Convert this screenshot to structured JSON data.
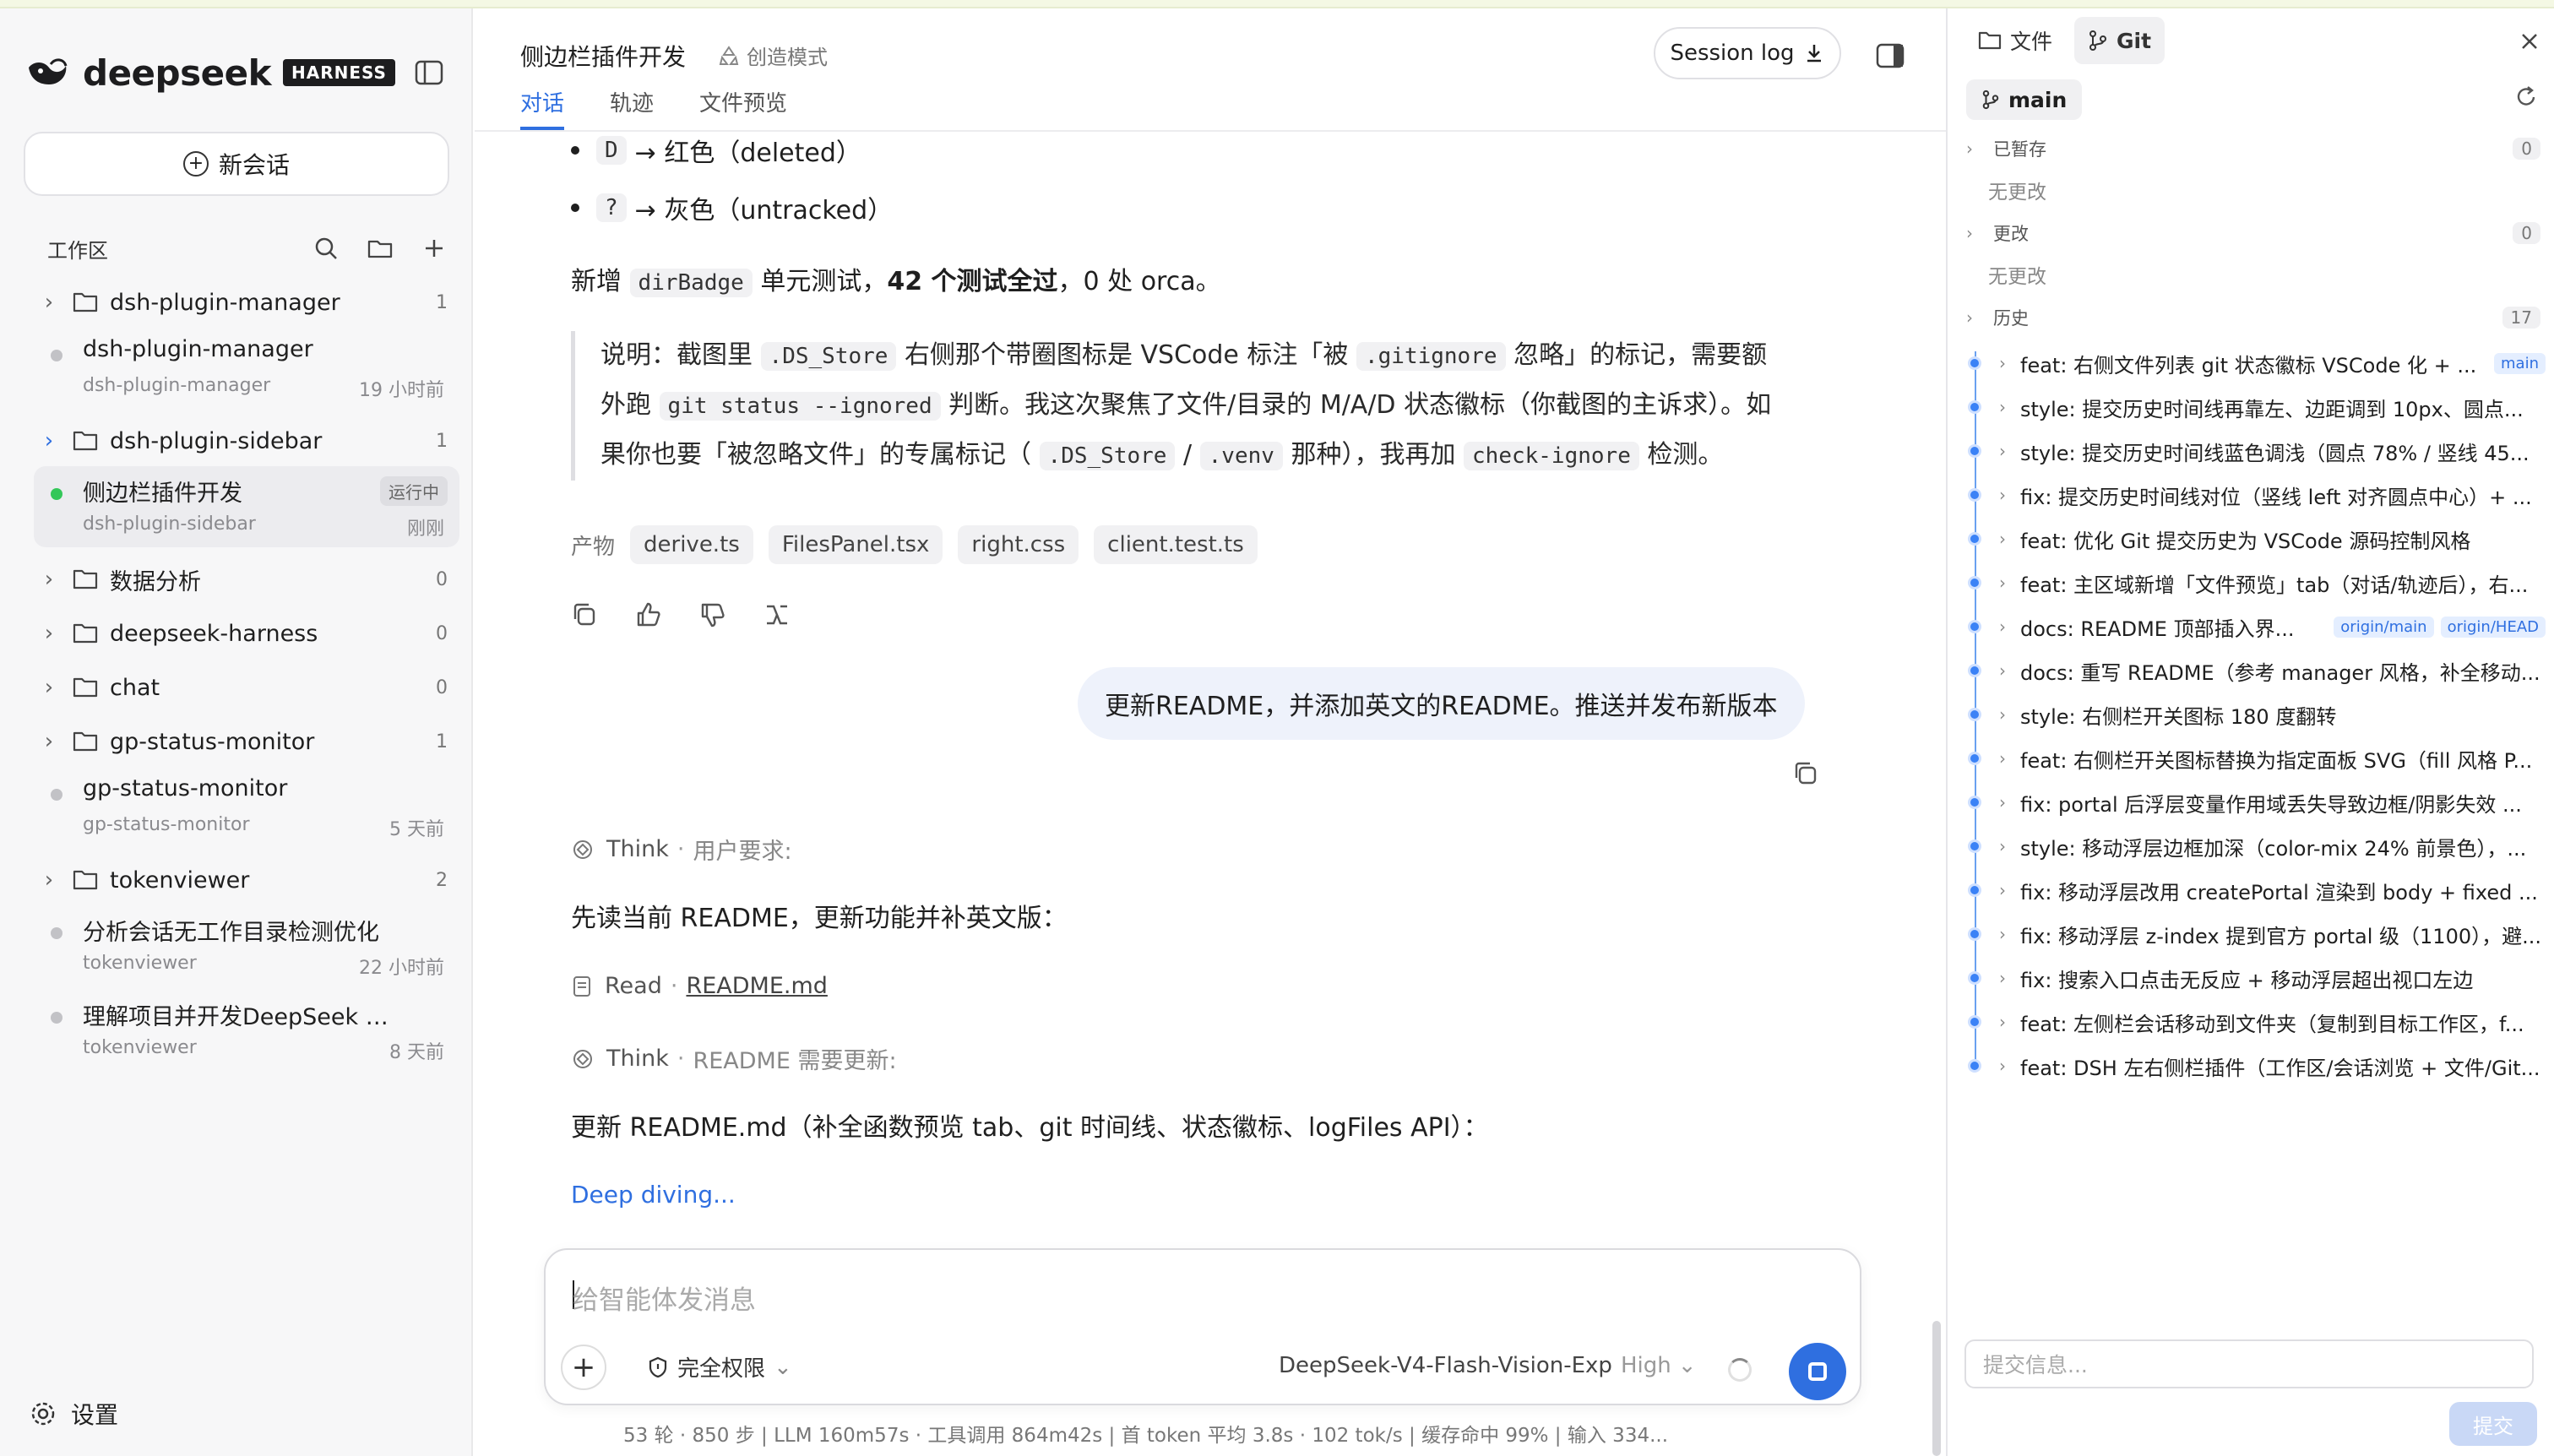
{
  "brand": {
    "name": "deepseek",
    "badge": "HARNESS"
  },
  "sidebar": {
    "new_chat": "新会话",
    "workspace_title": "工作区",
    "items": [
      {
        "kind": "folder",
        "name": "dsh-plugin-manager",
        "count": "1",
        "expanded": false
      },
      {
        "kind": "session",
        "title": "dsh-plugin-manager",
        "sub": "dsh-plugin-manager",
        "time": "19 小时前",
        "status": "idle"
      },
      {
        "kind": "folder",
        "name": "dsh-plugin-sidebar",
        "count": "1",
        "expanded": true
      },
      {
        "kind": "session",
        "title": "侧边栏插件开发",
        "sub": "dsh-plugin-sidebar",
        "time": "刚刚",
        "badge": "运行中",
        "status": "running"
      },
      {
        "kind": "folder",
        "name": "数据分析",
        "count": "0"
      },
      {
        "kind": "folder",
        "name": "deepseek-harness",
        "count": "0"
      },
      {
        "kind": "folder",
        "name": "chat",
        "count": "0"
      },
      {
        "kind": "folder",
        "name": "gp-status-monitor",
        "count": "1"
      },
      {
        "kind": "session",
        "title": "gp-status-monitor",
        "sub": "gp-status-monitor",
        "time": "5 天前",
        "status": "idle"
      },
      {
        "kind": "folder",
        "name": "tokenviewer",
        "count": "2"
      },
      {
        "kind": "session",
        "title": "分析会话无工作目录检测优化",
        "sub": "tokenviewer",
        "time": "22 小时前",
        "status": "idle"
      },
      {
        "kind": "session",
        "title": "理解项目并开发DeepSeek Harne...",
        "sub": "tokenviewer",
        "time": "8 天前",
        "status": "idle"
      }
    ],
    "settings": "设置"
  },
  "header": {
    "title": "侧边栏插件开发",
    "mode": "创造模式",
    "tabs": [
      "对话",
      "轨迹",
      "文件预览"
    ],
    "session_log": "Session log"
  },
  "conversation": {
    "bullet1_code": "D",
    "bullet1_text": "→ 红色（deleted）",
    "bullet2_code": "?",
    "bullet2_text": "→ 灰色（untracked）",
    "p1_a": "新增",
    "p1_code": "dirBadge",
    "p1_b": "单元测试，",
    "p1_bold": "42 个测试全过",
    "p1_c": "，0 处 orca。",
    "quote": {
      "t1": "说明：截图里",
      "c1": ".DS_Store",
      "t2": "右侧那个带圈图标是 VSCode 标注「被",
      "c2": ".gitignore",
      "t3": "忽略」的标记，需要额",
      "t4": "外跑",
      "c3": "git status --ignored",
      "t5": "判断。我这次聚焦了文件/目录的 M/A/D 状态徽标（你截图的主诉求）。如",
      "t6": "果你也要「被忽略文件」的专属标记（",
      "c4": ".DS_Store",
      "t7": "/",
      "c5": ".venv",
      "t8": "那种），我再加",
      "c6": "check-ignore",
      "t9": "检测。"
    },
    "artifacts_label": "产物",
    "artifacts": [
      "derive.ts",
      "FilesPanel.tsx",
      "right.css",
      "client.test.ts"
    ],
    "user_message": "更新README，并添加英文的README。推送并发布新版本",
    "think1_label": "Think",
    "think1_sub": "用户要求:",
    "p2": "先读当前 README，更新功能并补英文版：",
    "read_label": "Read",
    "read_file": "README.md",
    "think2_label": "Think",
    "think2_sub": "README 需要更新:",
    "p3": "更新 README.md（补全函数预览 tab、git 时间线、状态徽标、logFiles API）：",
    "deep_diving": "Deep diving..."
  },
  "composer": {
    "placeholder": "给智能体发消息",
    "permission": "完全权限",
    "model": "DeepSeek-V4-Flash-Vision-Exp",
    "level": "High"
  },
  "status_line": "53 轮 · 850 步   |   LLM 160m57s · 工具调用 864m42s   |   首 token 平均 3.8s · 102 tok/s   |   缓存命中 99%   |   输入 334...",
  "git": {
    "tabs": [
      "文件",
      "Git"
    ],
    "branch": "main",
    "staged_label": "已暂存",
    "staged_count": "0",
    "staged_empty": "无更改",
    "changes_label": "更改",
    "changes_count": "0",
    "changes_empty": "无更改",
    "history_label": "历史",
    "history_count": "17",
    "commits": [
      {
        "msg": "feat: 右侧文件列表 git 状态徽标 VSCode 化 + ...",
        "refs": [
          "main"
        ]
      },
      {
        "msg": "style: 提交历史时间线再靠左、边距调到 10px、圆点...",
        "refs": []
      },
      {
        "msg": "style: 提交历史时间线蓝色调浅（圆点 78% / 竖线 45...",
        "refs": []
      },
      {
        "msg": "fix: 提交历史时间线对位（竖线 left 对齐圆点中心）+ ...",
        "refs": []
      },
      {
        "msg": "feat: 优化 Git 提交历史为 VSCode 源码控制风格",
        "refs": []
      },
      {
        "msg": "feat: 主区域新增「文件预览」tab（对话/轨迹后），右...",
        "refs": []
      },
      {
        "msg": "docs: README 顶部插入界...",
        "refs": [
          "origin/main",
          "origin/HEAD"
        ]
      },
      {
        "msg": "docs: 重写 README（参考 manager 风格，补全移动...",
        "refs": []
      },
      {
        "msg": "style: 右侧栏开关图标 180 度翻转",
        "refs": []
      },
      {
        "msg": "feat: 右侧栏开关图标替换为指定面板 SVG（fill 风格 P...",
        "refs": []
      },
      {
        "msg": "fix: portal 后浮层变量作用域丢失导致边框/阴影失效 ...",
        "refs": []
      },
      {
        "msg": "style: 移动浮层边框加深（color-mix 24% 前景色），...",
        "refs": []
      },
      {
        "msg": "fix: 移动浮层改用 createPortal 渲染到 body + fixed ...",
        "refs": []
      },
      {
        "msg": "fix: 移动浮层 z-index 提到官方 portal 级（1100），避...",
        "refs": []
      },
      {
        "msg": "fix: 搜索入口点击无反应 + 移动浮层超出视口左边",
        "refs": []
      },
      {
        "msg": "feat: 左侧栏会话移动到文件夹（复制到目标工作区，f...",
        "refs": []
      },
      {
        "msg": "feat: DSH 左右侧栏插件（工作区/会话浏览 + 文件/Git...",
        "refs": []
      }
    ],
    "commit_placeholder": "提交信息...",
    "commit_button": "提交"
  },
  "colors": {
    "accent": "#2f6fe0",
    "running": "#34c759",
    "timeline": "#3b82f6"
  }
}
